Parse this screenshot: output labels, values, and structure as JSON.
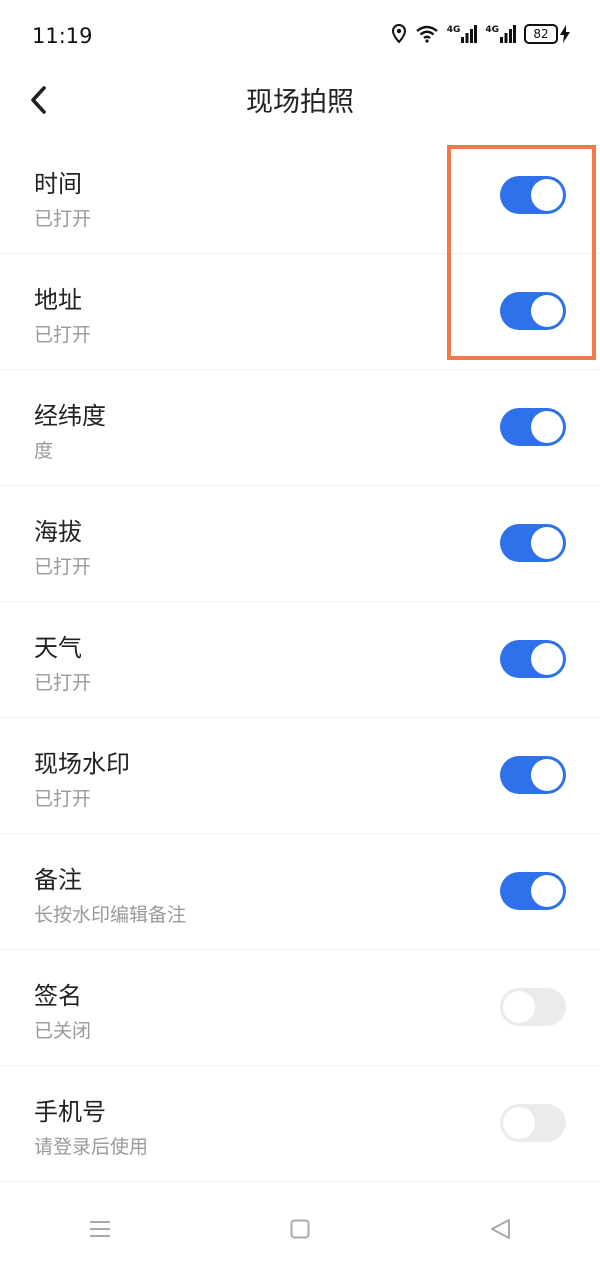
{
  "status": {
    "time": "11:19",
    "signal1": "4G",
    "signal2": "4G",
    "battery": "82"
  },
  "header": {
    "title": "现场拍照"
  },
  "settings": [
    {
      "title": "时间",
      "subtitle": "已打开",
      "enabled": true
    },
    {
      "title": "地址",
      "subtitle": "已打开",
      "enabled": true
    },
    {
      "title": "经纬度",
      "subtitle": "度",
      "enabled": true
    },
    {
      "title": "海拔",
      "subtitle": "已打开",
      "enabled": true
    },
    {
      "title": "天气",
      "subtitle": "已打开",
      "enabled": true
    },
    {
      "title": "现场水印",
      "subtitle": "已打开",
      "enabled": true
    },
    {
      "title": "备注",
      "subtitle": "长按水印编辑备注",
      "enabled": true
    },
    {
      "title": "签名",
      "subtitle": "已关闭",
      "enabled": false
    },
    {
      "title": "手机号",
      "subtitle": "请登录后使用",
      "enabled": false
    }
  ],
  "colors": {
    "toggle_on": "#2f71ea",
    "toggle_off": "#ebebeb",
    "highlight": "#f5784b"
  }
}
